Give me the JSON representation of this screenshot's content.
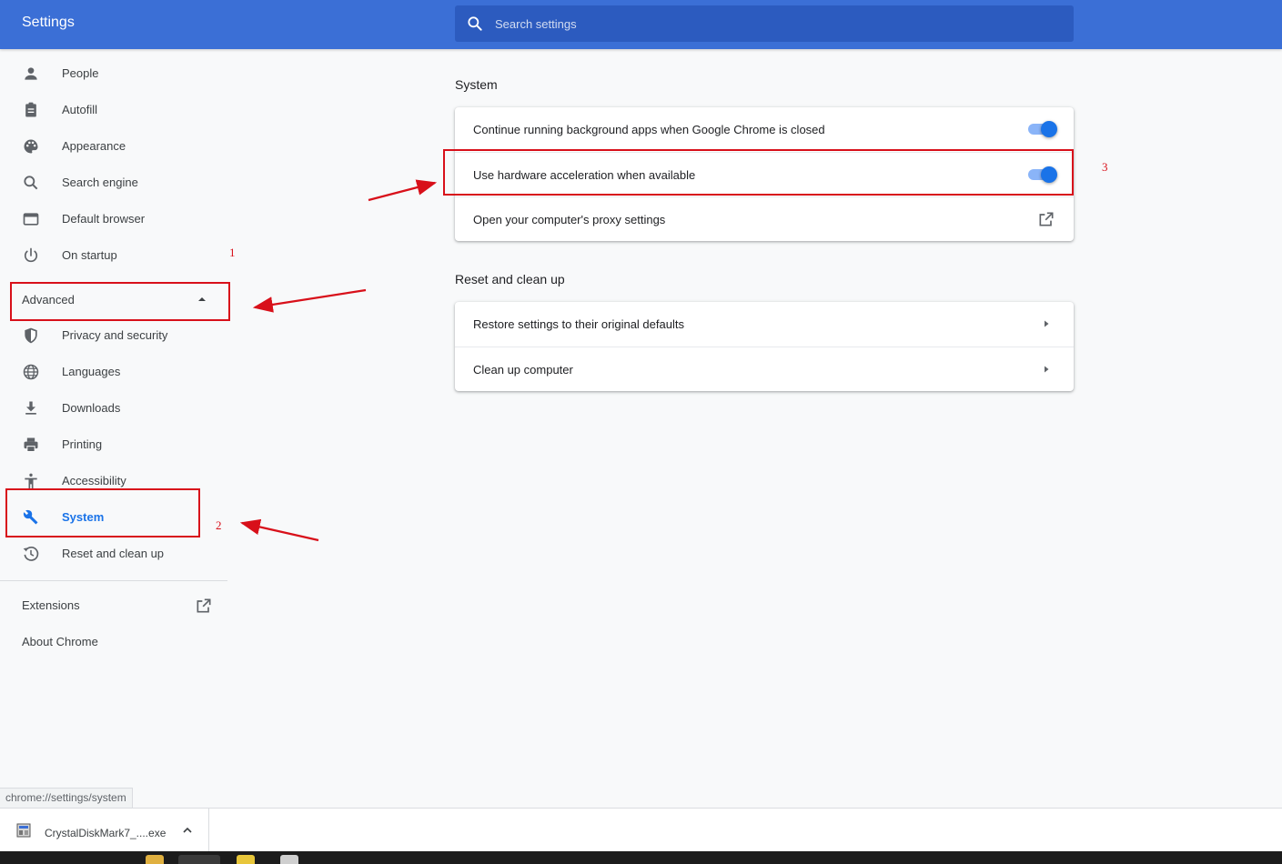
{
  "header": {
    "title": "Settings",
    "search_placeholder": "Search settings"
  },
  "sidebar": {
    "items": [
      {
        "label": "People",
        "icon": "person-icon"
      },
      {
        "label": "Autofill",
        "icon": "clipboard-icon"
      },
      {
        "label": "Appearance",
        "icon": "palette-icon"
      },
      {
        "label": "Search engine",
        "icon": "search-icon"
      },
      {
        "label": "Default browser",
        "icon": "browser-window-icon"
      },
      {
        "label": "On startup",
        "icon": "power-icon"
      }
    ],
    "advanced_label": "Advanced",
    "advanced_items": [
      {
        "label": "Privacy and security",
        "icon": "shield-icon"
      },
      {
        "label": "Languages",
        "icon": "globe-icon"
      },
      {
        "label": "Downloads",
        "icon": "download-icon"
      },
      {
        "label": "Printing",
        "icon": "printer-icon"
      },
      {
        "label": "Accessibility",
        "icon": "accessibility-icon"
      },
      {
        "label": "System",
        "icon": "wrench-icon",
        "active": true
      },
      {
        "label": "Reset and clean up",
        "icon": "history-icon"
      }
    ],
    "extensions_label": "Extensions",
    "about_label": "About Chrome"
  },
  "main": {
    "system": {
      "title": "System",
      "rows": [
        {
          "text": "Continue running background apps when Google Chrome is closed",
          "control": "toggle",
          "checked": true
        },
        {
          "text": "Use hardware acceleration when available",
          "control": "toggle",
          "checked": true
        },
        {
          "text": "Open your computer's proxy settings",
          "control": "open-in-new-icon"
        }
      ]
    },
    "reset": {
      "title": "Reset and clean up",
      "rows": [
        {
          "text": "Restore settings to their original defaults",
          "control": "arrow-right-icon"
        },
        {
          "text": "Clean up computer",
          "control": "arrow-right-icon"
        }
      ]
    }
  },
  "annotations": {
    "labels": [
      "1",
      "2",
      "3"
    ],
    "color": "#d8101a"
  },
  "statusbar": {
    "url": "chrome://settings/system"
  },
  "download_shelf": {
    "filename": "CrystalDiskMark7_....exe"
  },
  "colors": {
    "header": "#3b6fd6",
    "search": "#2c5bbf",
    "accent": "#1a73e8",
    "background": "#f8f9fa"
  }
}
